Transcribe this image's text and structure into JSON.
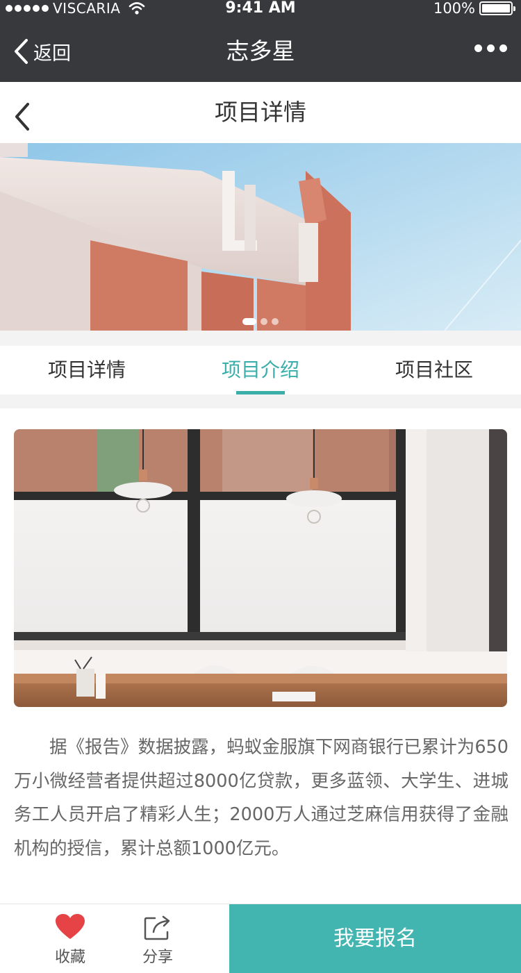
{
  "status_bar": {
    "carrier": "VISCARIA",
    "time": "9:41 AM",
    "battery": "100%"
  },
  "wechat_nav": {
    "back_label": "返回",
    "title": "志多星"
  },
  "page_header": {
    "title": "项目详情"
  },
  "banner": {
    "slide_count": 3,
    "active_index": 0
  },
  "tabs": [
    {
      "label": "项目详情",
      "active": false
    },
    {
      "label": "项目介绍",
      "active": true
    },
    {
      "label": "项目社区",
      "active": false
    }
  ],
  "content": {
    "paragraph": "据《报告》数据披露，蚂蚁金服旗下网商银行已累计为650万小微经营者提供超过8000亿贷款，更多蓝领、大学生、进城务工人员开启了精彩人生；2000万人通过芝麻信用获得了金融机构的授信，累计总额1000亿元。"
  },
  "bottom_bar": {
    "favorite_label": "收藏",
    "share_label": "分享",
    "signup_label": "我要报名"
  },
  "colors": {
    "accent": "#3aafa9",
    "signup_bg": "#43b5b0",
    "nav_bg": "#38393d",
    "heart": "#e54346"
  }
}
